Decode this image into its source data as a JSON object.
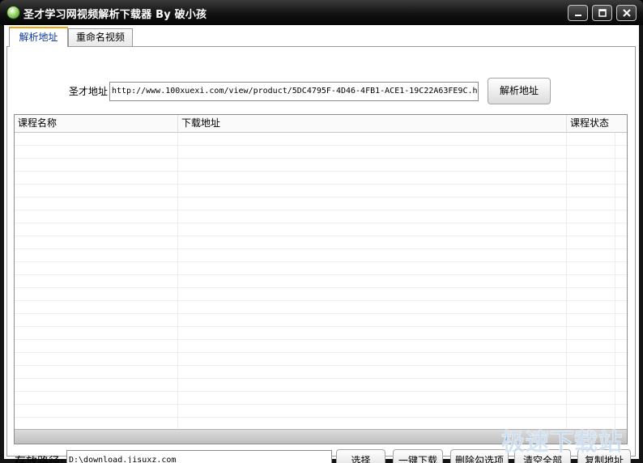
{
  "window": {
    "title": "圣才学习网视频解析下载器 By 破小孩",
    "controls": {
      "minimize_icon": "minimize-icon",
      "maximize_icon": "maximize-icon",
      "close_icon": "close-icon"
    }
  },
  "tabs": [
    {
      "label": "解析地址",
      "active": true
    },
    {
      "label": "重命名视频",
      "active": false
    }
  ],
  "url_section": {
    "label": "圣才地址",
    "value": "http://www.100xuexi.com/view/product/5DC4795F-4D46-4FB1-ACE1-19C22A63FE9C.h",
    "parse_button": "解析地址"
  },
  "grid": {
    "columns": [
      "课程名称",
      "下载地址",
      "课程状态"
    ],
    "rows": []
  },
  "bottom": {
    "path_label": "存放路径:",
    "path_value": "D:\\download.jisuxz.com",
    "buttons": {
      "select": "选择",
      "download_all": "一键下载",
      "delete_checked": "删除勾选项",
      "clear_all": "清空全部",
      "copy_address": "复制地址"
    }
  },
  "watermark": "极速下载站",
  "colors": {
    "titlebar": "#121212",
    "active_tab_accent": "#f2a40a",
    "active_tab_text": "#0a3aa0"
  }
}
